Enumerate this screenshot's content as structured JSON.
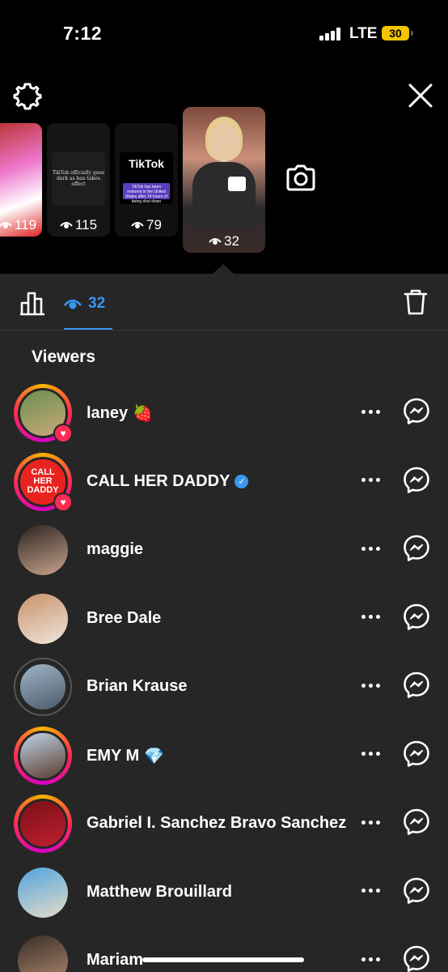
{
  "status": {
    "time": "7:12",
    "network": "LTE",
    "battery": "30"
  },
  "stories": [
    {
      "views": "119"
    },
    {
      "views": "115",
      "caption": "TikTok officially goes dark as ban takes effect"
    },
    {
      "views": "79",
      "logo": "TikTok",
      "caption": "TikTok has been restored in the United States after 14 hours of being shut down"
    },
    {
      "views": "32"
    }
  ],
  "tabs": {
    "viewers_count": "32"
  },
  "section_title": "Viewers",
  "viewers": [
    {
      "name": "laney",
      "emoji": "🍓",
      "liked": true,
      "ring": true,
      "colors": [
        "#6b8f4e",
        "#c9a97a"
      ]
    },
    {
      "name": "CALL HER DADDY",
      "verified": true,
      "liked": true,
      "ring": true,
      "logo_text": "CALL HER DADDY",
      "colors": [
        "#e8231f",
        "#e8231f"
      ]
    },
    {
      "name": "maggie",
      "ring": false,
      "colors": [
        "#2a2220",
        "#c8a48c"
      ]
    },
    {
      "name": "Bree Dale",
      "ring": false,
      "colors": [
        "#c9906a",
        "#f0e6dc"
      ]
    },
    {
      "name": "Brian Krause",
      "ring": false,
      "seen": true,
      "colors": [
        "#9fb5c8",
        "#4c5b6a"
      ]
    },
    {
      "name": "EMY M",
      "emoji": "💎",
      "ring": true,
      "colors": [
        "#bfd3e6",
        "#5a3b2e"
      ]
    },
    {
      "name": "Gabriel I. Sanchez Bravo Sanchez",
      "ring": true,
      "colors": [
        "#7a0f18",
        "#c02030"
      ]
    },
    {
      "name": "Matthew Brouillard",
      "ring": false,
      "colors": [
        "#4fa3df",
        "#e6dcc8"
      ]
    },
    {
      "name": "Mariam",
      "ring": false,
      "colors": [
        "#3a2e28",
        "#b08a70"
      ]
    }
  ]
}
